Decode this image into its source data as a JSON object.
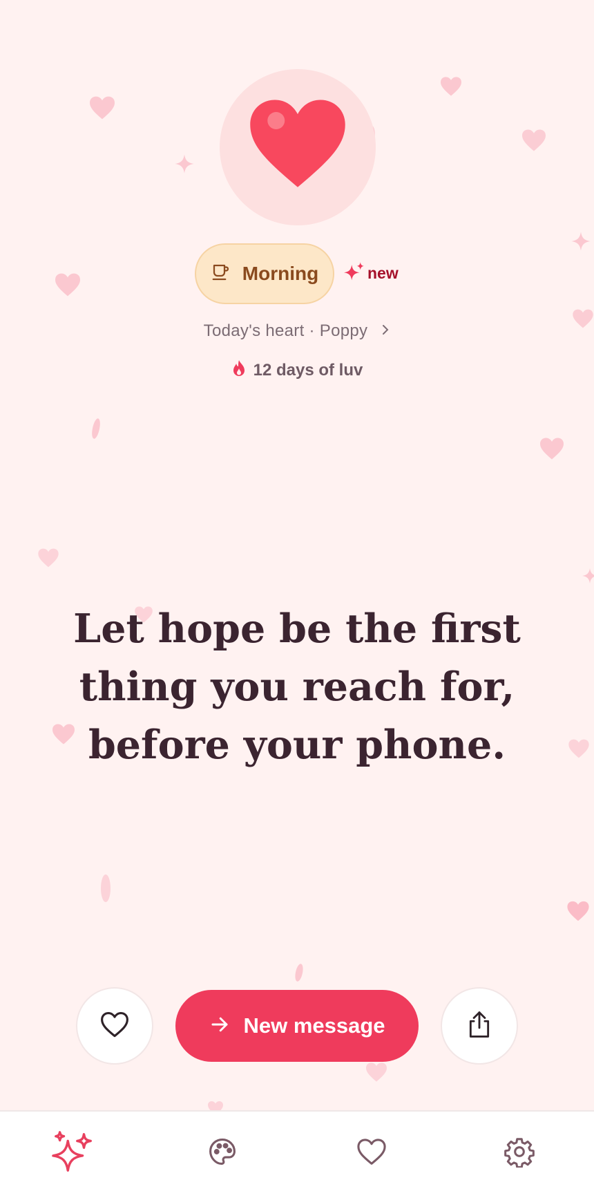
{
  "colors": {
    "background": "#fff2f1",
    "accent": "#ef3b5c",
    "heart": "#f8485e",
    "chip_bg": "#fde7c8",
    "nav_active": "#e8405e",
    "nav_inactive": "#7a5a66"
  },
  "hero": {
    "icon": "heart-icon"
  },
  "time_chip": {
    "icon": "cup-icon",
    "label": "Morning"
  },
  "badge": {
    "icon": "sparkle-icon",
    "label": "new"
  },
  "subtitle": {
    "text": "Today's heart · Poppy",
    "icon": "chevron-right-icon"
  },
  "streak": {
    "icon": "flame-icon",
    "text": "12 days of luv"
  },
  "quote": {
    "text": "Let hope be the first thing you reach for, before your phone."
  },
  "actions": {
    "favorite_icon": "heart-outline-icon",
    "primary_label": "New message",
    "primary_icon": "arrow-right-icon",
    "share_icon": "share-icon"
  },
  "bottom_nav": {
    "items": [
      {
        "icon": "sparkles-icon",
        "active": true
      },
      {
        "icon": "palette-icon",
        "active": false
      },
      {
        "icon": "heart-icon",
        "active": false
      },
      {
        "icon": "settings-gear-icon",
        "active": false
      }
    ]
  }
}
